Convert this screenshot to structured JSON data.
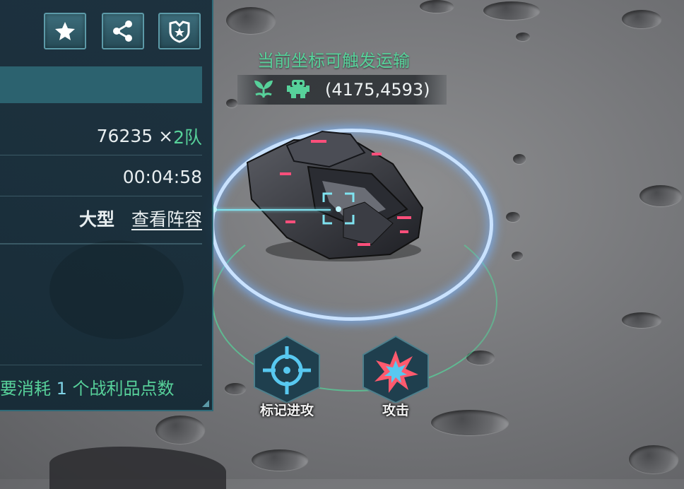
{
  "map": {
    "trigger_notice": "当前坐标可触发运输",
    "coordinate": "(4175,4593)",
    "icons": [
      "sprout-icon",
      "robot-icon"
    ]
  },
  "panel": {
    "toolbar": {
      "favorite_icon": "star-icon",
      "share_icon": "share-icon",
      "guild_icon": "shield-icon"
    },
    "power": {
      "value": "76235 ×",
      "teams": "2队"
    },
    "timer": "00:04:58",
    "size_label": "大型",
    "view_lineup_link": "查看阵容",
    "cost_note": {
      "prefix": "要消耗 ",
      "count": "1",
      "suffix": " 个战利品点数"
    }
  },
  "actions": {
    "mark_attack": "标记进攻",
    "attack": "攻击"
  },
  "colors": {
    "accent_green": "#57d19a",
    "panel_bg": "#162c3a",
    "ring_glow": "#c9e2ff"
  }
}
